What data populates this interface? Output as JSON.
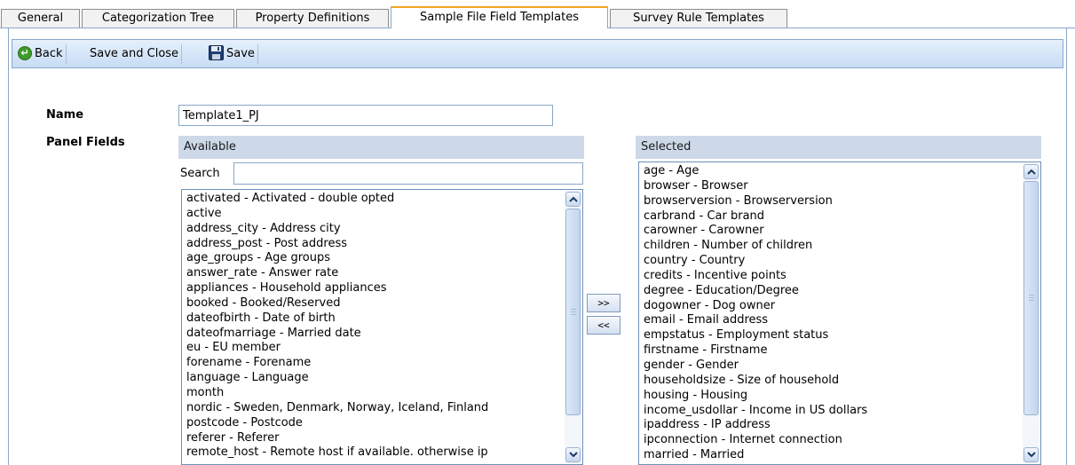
{
  "tabs": [
    {
      "label": "General"
    },
    {
      "label": "Categorization Tree"
    },
    {
      "label": "Property Definitions"
    },
    {
      "label": "Sample File Field Templates"
    },
    {
      "label": "Survey Rule Templates"
    }
  ],
  "active_tab": "Sample File Field Templates",
  "toolbar": {
    "back_label": "Back",
    "save_close_label": "Save and Close",
    "save_label": "Save"
  },
  "form": {
    "name_label": "Name",
    "name_value": "Template1_PJ",
    "panel_fields_label": "Panel Fields"
  },
  "available": {
    "header": "Available",
    "search_label": "Search",
    "search_value": "",
    "items": [
      "activated - Activated - double opted",
      "active",
      "address_city - Address city",
      "address_post - Post address",
      "age_groups - Age groups",
      "answer_rate - Answer rate",
      "appliances - Household appliances",
      "booked - Booked/Reserved",
      "dateofbirth - Date of birth",
      "dateofmarriage - Married date",
      "eu - EU member",
      "forename - Forename",
      "language - Language",
      "month",
      "nordic - Sweden, Denmark, Norway, Iceland, Finland",
      "postcode - Postcode",
      "referer - Referer",
      "remote_host - Remote host if available. otherwise ip"
    ]
  },
  "move_buttons": {
    "add_label": ">>",
    "remove_label": "<<"
  },
  "selected": {
    "header": "Selected",
    "items": [
      "age - Age",
      "browser - Browser",
      "browserversion - Browserversion",
      "carbrand - Car brand",
      "carowner - Carowner",
      "children - Number of children",
      "country - Country",
      "credits - Incentive points",
      "degree - Education/Degree",
      "dogowner - Dog owner",
      "email - Email address",
      "empstatus - Employment status",
      "firstname - Firstname",
      "gender - Gender",
      "householdsize - Size of household",
      "housing - Housing",
      "income_usdollar - Income in US dollars",
      "ipaddress - IP address",
      "ipconnection - Internet connection",
      "married - Married"
    ]
  },
  "colors": {
    "accent_tab": "#f5a623",
    "toolbar_bg": "#c7dcf4",
    "header_bg": "#cdd9e8",
    "border": "#8aa7c8"
  },
  "icons": {
    "back": "back-arrow-circle-icon",
    "save": "floppy-disk-icon",
    "scroll_up": "chevron-up-icon",
    "scroll_down": "chevron-down-icon"
  }
}
